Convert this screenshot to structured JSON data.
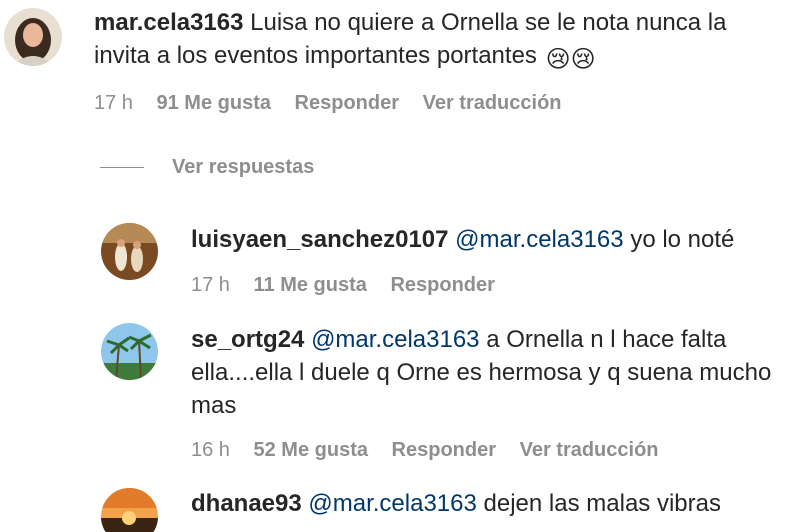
{
  "comments": [
    {
      "username": "mar.cela3163",
      "mention": "",
      "text": "Luisa no quiere a Ornella se le nota nunca la invita a los eventos importantes portantes",
      "emoji": "😢😢",
      "time": "17 h",
      "likes": "91 Me gusta",
      "reply": "Responder",
      "translate": "Ver traducción",
      "avatar_icon": "woman-portrait-avatar"
    }
  ],
  "replies_toggle": "Ver respuestas",
  "replies": [
    {
      "username": "luisyaen_sanchez0107",
      "mention": "@mar.cela3163",
      "text": "yo lo noté",
      "time": "17 h",
      "likes": "11 Me gusta",
      "reply": "Responder",
      "translate": "",
      "avatar_icon": "people-photo-avatar"
    },
    {
      "username": "se_ortg24",
      "mention": "@mar.cela3163",
      "text": "a Ornella n l hace falta ella....ella l duele q Orne es hermosa y q suena mucho mas",
      "time": "16 h",
      "likes": "52 Me gusta",
      "reply": "Responder",
      "translate": "Ver traducción",
      "avatar_icon": "palm-trees-avatar"
    },
    {
      "username": "dhanae93",
      "mention": "@mar.cela3163",
      "text": "dejen las malas vibras",
      "avatar_icon": "sunset-avatar"
    }
  ],
  "colors": {
    "text": "#262626",
    "secondary": "#8e8e8e",
    "mention": "#00376b"
  }
}
